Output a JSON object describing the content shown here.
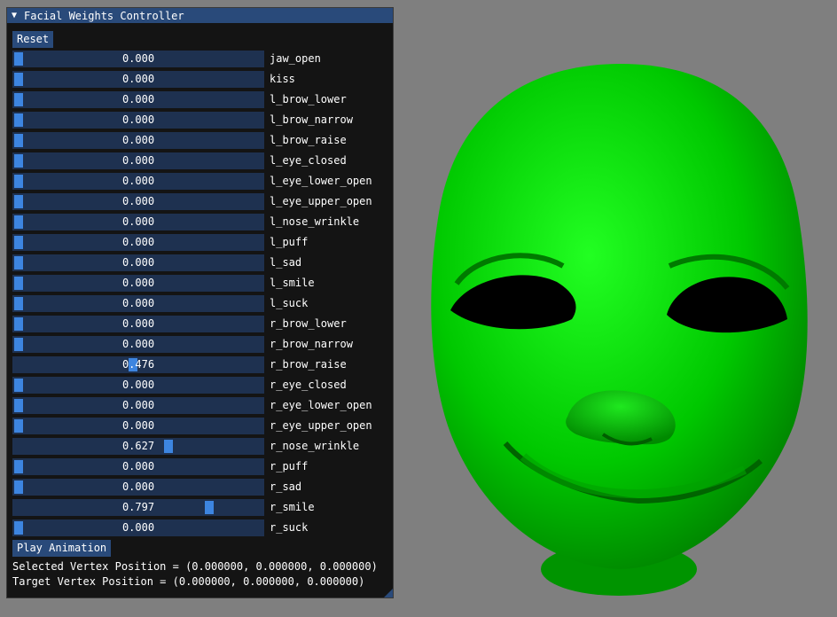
{
  "window": {
    "title": "Facial Weights Controller",
    "collapse_icon": "triangle-down-icon"
  },
  "buttons": {
    "reset": "Reset",
    "play": "Play Animation"
  },
  "sliders": [
    {
      "label": "jaw_open",
      "value": 0.0,
      "display": "0.000"
    },
    {
      "label": "kiss",
      "value": 0.0,
      "display": "0.000"
    },
    {
      "label": "l_brow_lower",
      "value": 0.0,
      "display": "0.000"
    },
    {
      "label": "l_brow_narrow",
      "value": 0.0,
      "display": "0.000"
    },
    {
      "label": "l_brow_raise",
      "value": 0.0,
      "display": "0.000"
    },
    {
      "label": "l_eye_closed",
      "value": 0.0,
      "display": "0.000"
    },
    {
      "label": "l_eye_lower_open",
      "value": 0.0,
      "display": "0.000"
    },
    {
      "label": "l_eye_upper_open",
      "value": 0.0,
      "display": "0.000"
    },
    {
      "label": "l_nose_wrinkle",
      "value": 0.0,
      "display": "0.000"
    },
    {
      "label": "l_puff",
      "value": 0.0,
      "display": "0.000"
    },
    {
      "label": "l_sad",
      "value": 0.0,
      "display": "0.000"
    },
    {
      "label": "l_smile",
      "value": 0.0,
      "display": "0.000"
    },
    {
      "label": "l_suck",
      "value": 0.0,
      "display": "0.000"
    },
    {
      "label": "r_brow_lower",
      "value": 0.0,
      "display": "0.000"
    },
    {
      "label": "r_brow_narrow",
      "value": 0.0,
      "display": "0.000"
    },
    {
      "label": "r_brow_raise",
      "value": 0.476,
      "display": "0.476"
    },
    {
      "label": "r_eye_closed",
      "value": 0.0,
      "display": "0.000"
    },
    {
      "label": "r_eye_lower_open",
      "value": 0.0,
      "display": "0.000"
    },
    {
      "label": "r_eye_upper_open",
      "value": 0.0,
      "display": "0.000"
    },
    {
      "label": "r_nose_wrinkle",
      "value": 0.627,
      "display": "0.627"
    },
    {
      "label": "r_puff",
      "value": 0.0,
      "display": "0.000"
    },
    {
      "label": "r_sad",
      "value": 0.0,
      "display": "0.000"
    },
    {
      "label": "r_smile",
      "value": 0.797,
      "display": "0.797"
    },
    {
      "label": "r_suck",
      "value": 0.0,
      "display": "0.000"
    }
  ],
  "info": {
    "selected_vertex": "Selected Vertex Position = (0.000000, 0.000000, 0.000000)",
    "target_vertex": "Target Vertex Position = (0.000000, 0.000000, 0.000000)"
  },
  "colors": {
    "background": "#7f7f7f",
    "panel_bg": "#141414",
    "title_bar": "#294a7a",
    "slider_track": "#1e3150",
    "slider_grab": "#3d85e0",
    "face": "#00c000"
  }
}
